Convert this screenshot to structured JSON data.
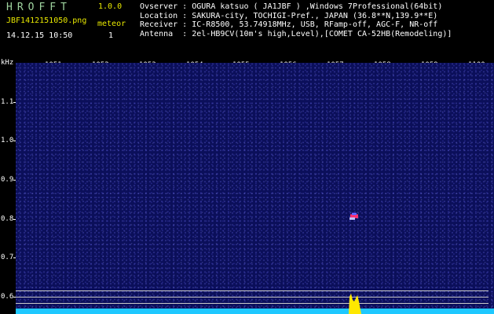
{
  "app": {
    "title": "HROFFT",
    "version": "1.0.0"
  },
  "file": {
    "name": "JBF1412151050.png",
    "timestamp": "14.12.15 10:50"
  },
  "meteor": {
    "label": "meteor",
    "count": "1"
  },
  "info": [
    {
      "label": "Ovserver :",
      "value": "OGURA katsuo ( JA1JBF ) ,Windows 7Professional(64bit)"
    },
    {
      "label": "Location :",
      "value": "SAKURA-city, TOCHIGI-Pref., JAPAN (36.8**N,139.9**E)"
    },
    {
      "label": "Receiver :",
      "value": "IC-R8500, 53.74918MHz, USB, RFamp-off, AGC-F, NR-off"
    },
    {
      "label": "Antenna  :",
      "value": "2el-HB9CV(10m's high,Level),[COMET CA-52HB(Remodeling)]"
    }
  ],
  "axis": {
    "x_unit": "kHz",
    "x_ticks": [
      "1051",
      "1052",
      "1053",
      "1054",
      "1055",
      "1056",
      "1057",
      "1058",
      "1059",
      "1100"
    ],
    "y_ticks": [
      "1.1",
      "1.0",
      "0.9",
      "0.8",
      "0.7",
      "0.6"
    ]
  },
  "colors": {
    "background": "#0b0f5a",
    "baseline": "#1ec8ff",
    "echo_peak": "#ffe800",
    "meteor_head": "#ff3070"
  }
}
